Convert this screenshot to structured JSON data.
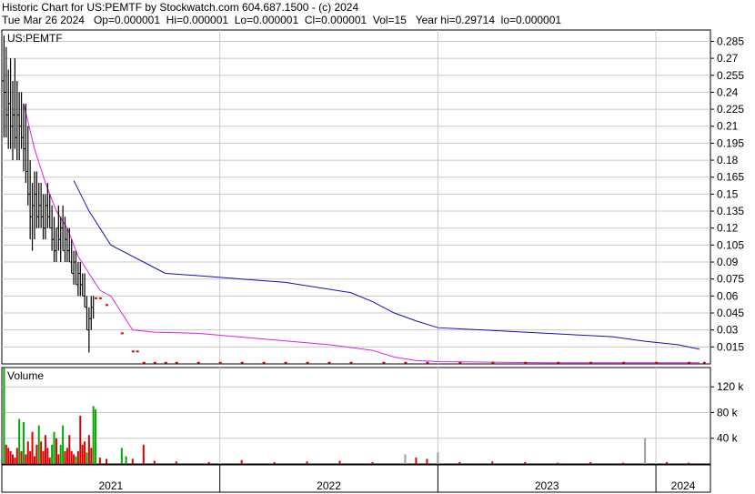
{
  "header": {
    "line1": "Historic Chart for US:PEMTF by Stockwatch.com 604.687.1500 - (c) 2024",
    "line2": "Tue Mar 26 2024   Op=0.000001  Hi=0.000001  Lo=0.000001  Cl=0.000001  Vol=15   Year hi=0.29714  lo=0.000001"
  },
  "colors": {
    "background": "#ffffff",
    "grid": "#c8c8c8",
    "price_bars": "#000000",
    "red_ticks": "#dd0000",
    "ma_short": "#e020e0",
    "ma_long": "#1010c0",
    "vol_up": "#00aa00",
    "vol_down": "#dd0000",
    "vol_flat": "#a0a0a0"
  },
  "chart_data": [
    {
      "type": "line",
      "title": "US:PEMTF",
      "y_axis_side": "right",
      "ylim": [
        0.0,
        0.295
      ],
      "ytick_labels": [
        "0.285",
        "0.27",
        "0.255",
        "0.24",
        "0.225",
        "0.21",
        "0.195",
        "0.18",
        "0.165",
        "0.15",
        "0.135",
        "0.12",
        "0.105",
        "0.09",
        "0.075",
        "0.06",
        "0.045",
        "0.03",
        "0.015"
      ],
      "xlim": [
        2021.0,
        2024.25
      ],
      "grid": true,
      "price_bars": [
        [
          2021.01,
          0.25,
          0.29,
          0.2
        ],
        [
          2021.02,
          0.24,
          0.28,
          0.2
        ],
        [
          2021.03,
          0.22,
          0.26,
          0.19
        ],
        [
          2021.04,
          0.23,
          0.27,
          0.19
        ],
        [
          2021.05,
          0.21,
          0.25,
          0.18
        ],
        [
          2021.06,
          0.22,
          0.27,
          0.19
        ],
        [
          2021.07,
          0.2,
          0.25,
          0.18
        ],
        [
          2021.08,
          0.22,
          0.24,
          0.18
        ],
        [
          2021.09,
          0.21,
          0.24,
          0.19
        ],
        [
          2021.1,
          0.2,
          0.23,
          0.17
        ],
        [
          2021.11,
          0.19,
          0.23,
          0.16
        ],
        [
          2021.12,
          0.17,
          0.21,
          0.14
        ],
        [
          2021.13,
          0.15,
          0.18,
          0.11
        ],
        [
          2021.14,
          0.13,
          0.16,
          0.1
        ],
        [
          2021.15,
          0.14,
          0.17,
          0.11
        ],
        [
          2021.16,
          0.15,
          0.17,
          0.12
        ],
        [
          2021.17,
          0.13,
          0.16,
          0.12
        ],
        [
          2021.18,
          0.14,
          0.16,
          0.12
        ],
        [
          2021.19,
          0.13,
          0.15,
          0.11
        ],
        [
          2021.2,
          0.12,
          0.15,
          0.11
        ],
        [
          2021.21,
          0.14,
          0.16,
          0.12
        ],
        [
          2021.22,
          0.13,
          0.15,
          0.12
        ],
        [
          2021.23,
          0.12,
          0.14,
          0.1
        ],
        [
          2021.24,
          0.11,
          0.13,
          0.09
        ],
        [
          2021.25,
          0.1,
          0.12,
          0.09
        ],
        [
          2021.26,
          0.12,
          0.14,
          0.1
        ],
        [
          2021.27,
          0.11,
          0.13,
          0.09
        ],
        [
          2021.28,
          0.12,
          0.14,
          0.1
        ],
        [
          2021.29,
          0.1,
          0.13,
          0.09
        ],
        [
          2021.3,
          0.11,
          0.12,
          0.09
        ],
        [
          2021.31,
          0.1,
          0.12,
          0.09
        ],
        [
          2021.32,
          0.09,
          0.11,
          0.08
        ],
        [
          2021.33,
          0.08,
          0.1,
          0.07
        ],
        [
          2021.34,
          0.09,
          0.1,
          0.07
        ],
        [
          2021.35,
          0.07,
          0.09,
          0.06
        ],
        [
          2021.36,
          0.08,
          0.09,
          0.06
        ],
        [
          2021.37,
          0.07,
          0.08,
          0.06
        ],
        [
          2021.38,
          0.06,
          0.08,
          0.05
        ],
        [
          2021.39,
          0.05,
          0.06,
          0.03
        ],
        [
          2021.4,
          0.03,
          0.05,
          0.01
        ],
        [
          2021.41,
          0.04,
          0.06,
          0.03
        ],
        [
          2021.42,
          0.05,
          0.06,
          0.04
        ]
      ],
      "series": [
        {
          "color": "#e020e0",
          "x": [
            2021.1,
            2021.15,
            2021.2,
            2021.25,
            2021.3,
            2021.35,
            2021.4,
            2021.45,
            2021.5,
            2021.55,
            2021.6,
            2021.7,
            2021.9,
            2022.2,
            2022.5,
            2022.7,
            2022.8,
            2022.9,
            2023.0,
            2023.5,
            2024.0,
            2024.2
          ],
          "values": [
            0.23,
            0.19,
            0.16,
            0.135,
            0.12,
            0.095,
            0.08,
            0.065,
            0.06,
            0.045,
            0.03,
            0.028,
            0.027,
            0.022,
            0.017,
            0.012,
            0.006,
            0.003,
            0.002,
            0.001,
            0.001,
            0.001
          ]
        },
        {
          "color": "#1010c0",
          "x": [
            2021.33,
            2021.4,
            2021.5,
            2021.6,
            2021.7,
            2021.75,
            2021.9,
            2022.1,
            2022.3,
            2022.5,
            2022.6,
            2022.7,
            2022.8,
            2022.9,
            2023.0,
            2023.2,
            2023.4,
            2023.6,
            2023.8,
            2023.95,
            2024.0,
            2024.1,
            2024.2
          ],
          "values": [
            0.162,
            0.135,
            0.105,
            0.095,
            0.085,
            0.08,
            0.078,
            0.075,
            0.072,
            0.066,
            0.063,
            0.055,
            0.045,
            0.038,
            0.032,
            0.03,
            0.028,
            0.026,
            0.024,
            0.02,
            0.019,
            0.017,
            0.013
          ]
        }
      ],
      "red_ticks": [
        [
          2021.43,
          0.058
        ],
        [
          2021.45,
          0.058
        ],
        [
          2021.48,
          0.052
        ],
        [
          2021.55,
          0.027
        ],
        [
          2021.6,
          0.011
        ],
        [
          2021.62,
          0.011
        ],
        [
          2021.65,
          0.001
        ],
        [
          2021.7,
          0.001
        ],
        [
          2021.75,
          0.001
        ],
        [
          2021.8,
          0.001
        ],
        [
          2021.9,
          0.001
        ],
        [
          2022.0,
          0.001
        ],
        [
          2022.1,
          0.001
        ],
        [
          2022.2,
          0.001
        ],
        [
          2022.3,
          0.001
        ],
        [
          2022.4,
          0.001
        ],
        [
          2022.5,
          0.001
        ],
        [
          2022.6,
          0.001
        ],
        [
          2022.75,
          0.001
        ],
        [
          2022.85,
          0.001
        ],
        [
          2022.95,
          0.001
        ],
        [
          2023.1,
          0.001
        ],
        [
          2023.25,
          0.001
        ],
        [
          2023.4,
          0.001
        ],
        [
          2023.55,
          0.001
        ],
        [
          2023.7,
          0.001
        ],
        [
          2023.85,
          0.001
        ],
        [
          2024.0,
          0.001
        ],
        [
          2024.15,
          0.001
        ],
        [
          2024.22,
          0.001
        ]
      ]
    },
    {
      "type": "bar",
      "title": "Volume",
      "y_axis_side": "right",
      "ylim": [
        0,
        150000
      ],
      "ytick_labels": [
        "120 k",
        "80 k",
        "40 k"
      ],
      "xlim": [
        2021.0,
        2024.25
      ],
      "x_labels": [
        "2021",
        "2022",
        "2023",
        "2024"
      ],
      "bars": [
        [
          2021.01,
          150000,
          "up"
        ],
        [
          2021.02,
          30000,
          "down"
        ],
        [
          2021.03,
          25000,
          "down"
        ],
        [
          2021.04,
          20000,
          "down"
        ],
        [
          2021.05,
          15000,
          "down"
        ],
        [
          2021.06,
          10000,
          "down"
        ],
        [
          2021.07,
          25000,
          "down"
        ],
        [
          2021.08,
          70000,
          "up"
        ],
        [
          2021.09,
          20000,
          "down"
        ],
        [
          2021.1,
          65000,
          "up"
        ],
        [
          2021.11,
          15000,
          "down"
        ],
        [
          2021.12,
          35000,
          "down"
        ],
        [
          2021.13,
          20000,
          "down"
        ],
        [
          2021.14,
          50000,
          "down"
        ],
        [
          2021.15,
          12000,
          "down"
        ],
        [
          2021.16,
          30000,
          "down"
        ],
        [
          2021.17,
          60000,
          "up"
        ],
        [
          2021.18,
          35000,
          "down"
        ],
        [
          2021.19,
          20000,
          "down"
        ],
        [
          2021.2,
          45000,
          "down"
        ],
        [
          2021.21,
          25000,
          "down"
        ],
        [
          2021.22,
          10000,
          "down"
        ],
        [
          2021.23,
          30000,
          "up"
        ],
        [
          2021.24,
          50000,
          "up"
        ],
        [
          2021.25,
          40000,
          "down"
        ],
        [
          2021.26,
          15000,
          "down"
        ],
        [
          2021.27,
          30000,
          "up"
        ],
        [
          2021.28,
          60000,
          "up"
        ],
        [
          2021.29,
          20000,
          "down"
        ],
        [
          2021.3,
          25000,
          "down"
        ],
        [
          2021.31,
          45000,
          "down"
        ],
        [
          2021.32,
          20000,
          "down"
        ],
        [
          2021.33,
          15000,
          "down"
        ],
        [
          2021.34,
          12000,
          "up"
        ],
        [
          2021.35,
          20000,
          "down"
        ],
        [
          2021.36,
          75000,
          "down"
        ],
        [
          2021.37,
          30000,
          "down"
        ],
        [
          2021.38,
          35000,
          "down"
        ],
        [
          2021.39,
          18000,
          "up"
        ],
        [
          2021.4,
          45000,
          "down"
        ],
        [
          2021.41,
          25000,
          "down"
        ],
        [
          2021.42,
          90000,
          "up"
        ],
        [
          2021.43,
          85000,
          "up"
        ],
        [
          2021.45,
          10000,
          "down"
        ],
        [
          2021.48,
          8000,
          "down"
        ],
        [
          2021.55,
          25000,
          "up"
        ],
        [
          2021.57,
          12000,
          "up"
        ],
        [
          2021.6,
          8000,
          "down"
        ],
        [
          2021.65,
          30000,
          "down"
        ],
        [
          2021.7,
          5000,
          "down"
        ],
        [
          2021.8,
          4000,
          "down"
        ],
        [
          2021.95,
          3000,
          "down"
        ],
        [
          2022.1,
          6000,
          "down"
        ],
        [
          2022.25,
          3000,
          "down"
        ],
        [
          2022.4,
          4000,
          "down"
        ],
        [
          2022.55,
          5000,
          "down"
        ],
        [
          2022.7,
          3000,
          "down"
        ],
        [
          2022.85,
          15000,
          "flat"
        ],
        [
          2022.9,
          10000,
          "down"
        ],
        [
          2022.95,
          8000,
          "down"
        ],
        [
          2023.0,
          18000,
          "flat"
        ],
        [
          2023.1,
          3000,
          "down"
        ],
        [
          2023.25,
          4000,
          "down"
        ],
        [
          2023.4,
          3000,
          "down"
        ],
        [
          2023.55,
          2000,
          "down"
        ],
        [
          2023.7,
          3000,
          "down"
        ],
        [
          2023.85,
          2000,
          "down"
        ],
        [
          2023.95,
          40000,
          "flat"
        ],
        [
          2024.05,
          3000,
          "down"
        ],
        [
          2024.15,
          2000,
          "down"
        ]
      ]
    }
  ]
}
